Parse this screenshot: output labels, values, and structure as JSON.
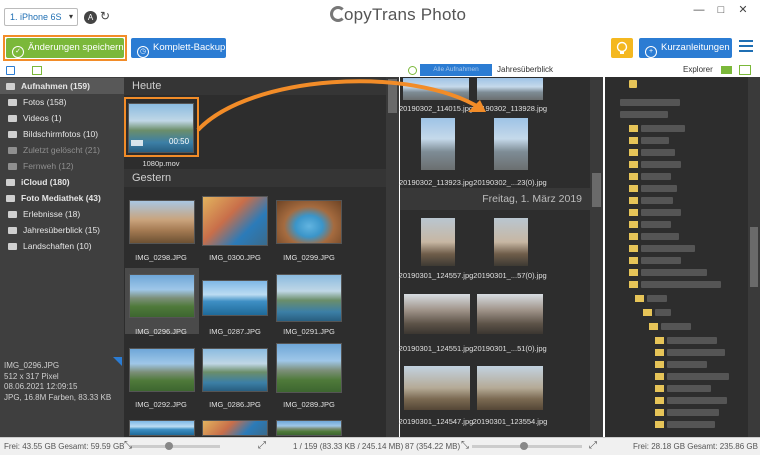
{
  "app": {
    "title": "CopyTrans Photo",
    "logo_rest": "opyTrans Photo"
  },
  "device": {
    "label": "1. iPhone 6S"
  },
  "window_buttons": [
    "—",
    "□",
    "✕"
  ],
  "toolbar": {
    "save_label": "Änderungen speichern",
    "backup_label": "Komplett-Backup",
    "guides_label": "Kurzanleitungen"
  },
  "explorer": {
    "label": "Explorer"
  },
  "sidebar": {
    "items": [
      {
        "label": "Aufnahmen (159)",
        "bold": true
      },
      {
        "label": "Fotos (158)"
      },
      {
        "label": "Videos (1)"
      },
      {
        "label": "Bildschirmfotos (10)"
      },
      {
        "label": "Zuletzt gelöscht (21)",
        "dim": true
      },
      {
        "label": "Fernweh (12)",
        "dim": true
      },
      {
        "label": "iCloud (180)",
        "bold": true
      },
      {
        "label": "Foto Mediathek (43)",
        "bold": true
      },
      {
        "label": "Erlebnisse (18)"
      },
      {
        "label": "Jahresüberblick (15)"
      },
      {
        "label": "Landschaften (10)"
      }
    ]
  },
  "info": {
    "name": "IMG_0296.JPG",
    "dims": "512 x 317 Pixel",
    "date": "08.06.2021 12:09:15",
    "meta": "JPG, 16.8M Farben, 83.33 KB"
  },
  "middle": {
    "section_today": "Heute",
    "section_yesterday": "Gestern",
    "video": {
      "caption": "1080p.mov",
      "duration": "00:50"
    },
    "photos": [
      "IMG_0298.JPG",
      "IMG_0300.JPG",
      "IMG_0299.JPG",
      "IMG_0296.JPG",
      "IMG_0287.JPG",
      "IMG_0291.JPG",
      "IMG_0292.JPG",
      "IMG_0286.JPG",
      "IMG_0289.JPG"
    ]
  },
  "right": {
    "tab_active": "Alle Aufnahmen",
    "tab_other": "Jahresüberblick",
    "date_header": "Freitag, 1. März 2019",
    "photos": [
      "20190302_114015.jpg",
      "20190302_113928.jpg",
      "20190302_113923.jpg",
      "20190302_...23(0).jpg",
      "20190301_124557.jpg",
      "20190301_...57(0).jpg",
      "20190301_124551.jpg",
      "20190301_...51(0).jpg",
      "20190301_124547.jpg",
      "20190301_123554.jpg"
    ]
  },
  "status": {
    "left": "Frei: 43.55 GB Gesamt: 59.59 GB",
    "middle": "1 / 159 (83.33 KB / 245.14 MB)",
    "right_count": "87 (354.22 MB)",
    "right": "Frei: 28.18 GB Gesamt: 235.86 GB"
  }
}
